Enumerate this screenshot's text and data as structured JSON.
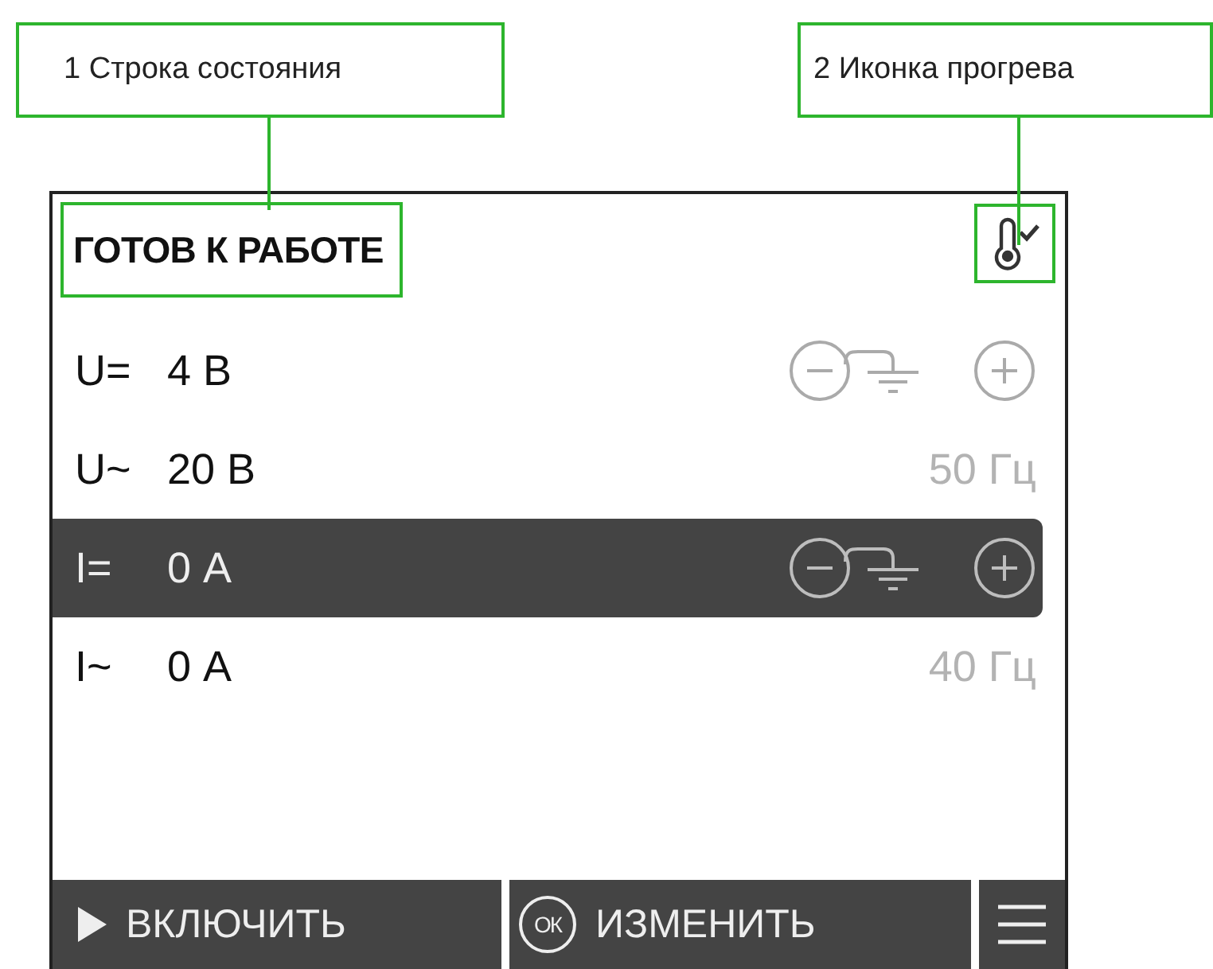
{
  "callouts": [
    {
      "text": "1 Строка состояния"
    },
    {
      "text": "2 Иконка прогрева"
    }
  ],
  "status_bar": {
    "text": "ГОТОВ К РАБОТЕ",
    "warmup_done": true
  },
  "rows": [
    {
      "label": "U=",
      "value": "4 В",
      "kind": "polarity",
      "selected": false
    },
    {
      "label": "U~",
      "value": "20 В",
      "kind": "frequency",
      "frequency": "50 Гц",
      "selected": false
    },
    {
      "label": "I=",
      "value": "0 А",
      "kind": "polarity",
      "selected": true
    },
    {
      "label": "I~",
      "value": "0 А",
      "kind": "frequency",
      "frequency": "40 Гц",
      "selected": false
    }
  ],
  "buttons": [
    {
      "kind": "play",
      "label": "ВКЛЮЧИТЬ"
    },
    {
      "kind": "ok",
      "label": "ИЗМЕНИТЬ",
      "badge": "ОК"
    },
    {
      "kind": "menu"
    }
  ]
}
